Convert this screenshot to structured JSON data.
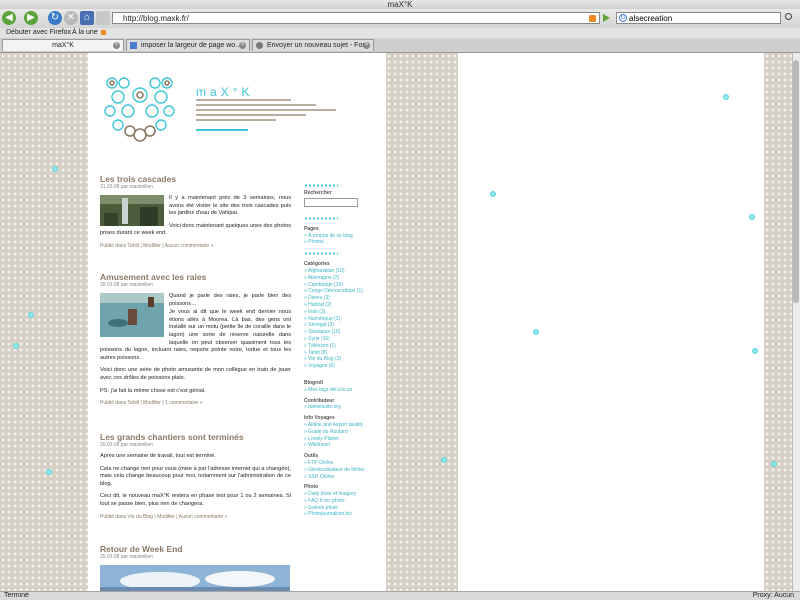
{
  "window": {
    "title": "maX°K"
  },
  "toolbar": {
    "url": "http://blog.maxk.fr/",
    "search_value": "alsecreation"
  },
  "bookmarks": {
    "items": [
      "Débuter avec Firefox",
      "À la une"
    ]
  },
  "tabs": [
    {
      "label": "maX°K",
      "active": true
    },
    {
      "label": "imposer la largeur de page wo...",
      "active": false
    },
    {
      "label": "Envoyer un nouveau sujet - For...",
      "active": false
    }
  ],
  "site": {
    "title": "maX°K"
  },
  "posts": [
    {
      "title": "Les trois cascades",
      "meta": "31.03.08 par maximilien",
      "paragraphs": [
        "Il y a maintenant près de 3 semaines, nous avons été visiter le site des trois cascades puis les jardins d'eau de Vahipai.",
        "Voici donc maintenant quelques unes des photos prises durant ce week end."
      ],
      "footer": "Publié dans Tahiti | Modifier | Aucun commentaire »"
    },
    {
      "title": "Amusement avec les raies",
      "meta": "28.03.08 par maximilien",
      "paragraphs": [
        "Quand je parle des raies, je parle bien des poissons…",
        "Je vous ai dit que le week end dernier nous étions allés à Moorea. Là bas, des gens ont installé sur un motu (petite île de coraille dans le lagon) une sorte de réserve naturelle dans laquelle on peut observer quasiment tous les poissons du lagon, incluant raies, requins pointe noire, tortue et tous les autres poissons.",
        "Voici donc une série de photo amusante de mon collègue en train de jouer avec ces drôles de poissons plats.",
        "PS: j'ai fait la même chose est c'est génial."
      ],
      "footer": "Publié dans Tahiti | Modifier | 1 commentaire »"
    },
    {
      "title": "Les grands chantiers sont terminés",
      "meta": "26.03.08 par maximilien",
      "paragraphs": [
        "Après une semaine de travail, tout est terminé.",
        "Cela ne change rien pour vous (mise à par l'adresse internet qui a changée), mais cela change beaucoup pour moi, notamment sur l'administration de ce blog.",
        "Ceci dit, le nouveau maX°K restera en phase test pour 1 ou 2 semaines. Si tout se passe bien, plus rien de changera."
      ],
      "footer": "Publié dans Vie du Blog | Modifier | Aucun commentaire »"
    },
    {
      "title": "Retour de Week End",
      "meta": "25.03.08 par maximilien",
      "paragraphs": [],
      "footer": ""
    }
  ],
  "sidebar": {
    "search_label": "Rechercher",
    "pages_title": "Pages",
    "pages": [
      "» À propos de ce blog",
      "» Photos"
    ],
    "categories_title": "Catégories",
    "categories": [
      "» Afghanistan (10)",
      "» Allemagne (2)",
      "» Cambodge (19)",
      "» Congo Démocratique (1)",
      "» Divers (3)",
      "» Habitat (2)",
      "» Inde (3)",
      "» Numérique (1)",
      "» Sénégal (3)",
      "» Slovaquie (16)",
      "» Syrie (16)",
      "» Téléicom (1)",
      "» Tahiti (8)",
      "» Vie du Blog (3)",
      "» Voyages (6)"
    ],
    "blogroll_title": "Blogroll",
    "blogroll": [
      "» Mes tags del.icio.us"
    ],
    "contrib_title": "Contributeur",
    "contrib": [
      "» danielsuite.org"
    ],
    "voyages_title": "Info Voyages",
    "voyages": [
      "» Airline and Airport quality",
      "» Guide du Routard",
      "» Lonely Planet",
      "» Wikitravel"
    ],
    "outils_title": "Outils",
    "outils": [
      "» FTP Online",
      "» Géolocalisateur de fichier",
      "» SSH Online"
    ],
    "photo_title": "Photo",
    "photo": [
      "» Daily dose of imagery",
      "» FAQ fr.rec.photo",
      "» Galerie photo",
      "» Photojournalism.biz"
    ]
  },
  "status": {
    "left": "Terminé",
    "right": "Proxy: Aucun"
  },
  "colors": {
    "accent": "#3dc6d6",
    "heading": "#8a7a66",
    "lace": "#d6cfc5"
  },
  "icons": [
    "back-icon",
    "forward-icon",
    "reload-icon",
    "stop-icon",
    "home-icon",
    "page-icon",
    "rss-icon",
    "go-icon",
    "google-icon",
    "search-icon"
  ]
}
